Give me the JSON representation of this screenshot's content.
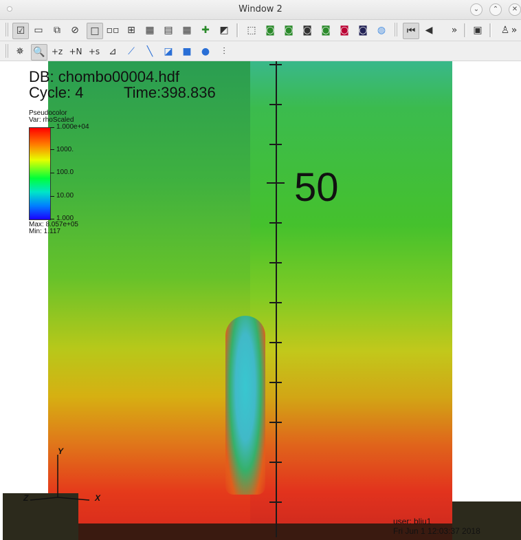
{
  "window": {
    "title": "Window 2"
  },
  "toolbar": {
    "row1": [
      "select-icon",
      "new-window-icon",
      "copy-window-icon",
      "delete-window-icon",
      "layout-1x1-icon",
      "layout-1x2-icon",
      "layout-2x2-icon",
      "layout-2x3-icon",
      "layout-2x4-icon",
      "layout-3x3-icon",
      "tools-icon",
      "color-table-icon",
      "box-3d-icon",
      "cam1-icon",
      "cam2-icon",
      "cam3-icon",
      "cam4-icon",
      "cam5-icon",
      "cam6-icon",
      "globe-icon",
      "prev-frame-icon",
      "play-back-icon",
      "more-icon",
      "settings-icon",
      "lock-icon",
      "more-right-icon"
    ],
    "row2": [
      "navigate-icon",
      "zoom-icon",
      "pick-z-icon",
      "pick-n-icon",
      "pick-s-icon",
      "lineout-icon",
      "line-tool-icon",
      "box-tool-icon",
      "cube-icon",
      "sphere-icon",
      "slider-icon"
    ],
    "more_label": "»"
  },
  "viz": {
    "db_label": "DB: chombo00004.hdf",
    "cycle_label": "Cycle: 4",
    "time_label": "Time:398.836",
    "legend_type": "Pseudocolor",
    "legend_var": "Var: rhoScaled",
    "legend_ticks": [
      "1.000e+04",
      "1000.",
      "100.0",
      "10.00",
      "1.000"
    ],
    "max_label": "Max:  8.057e+05",
    "min_label": "Min:  1.117",
    "axis_value_label": "50",
    "triad": {
      "y": "Y",
      "x": "X",
      "z": "Z"
    },
    "user_label": "user: bliu1",
    "date_label": "Fri Jun  1 12:03:37 2018"
  }
}
